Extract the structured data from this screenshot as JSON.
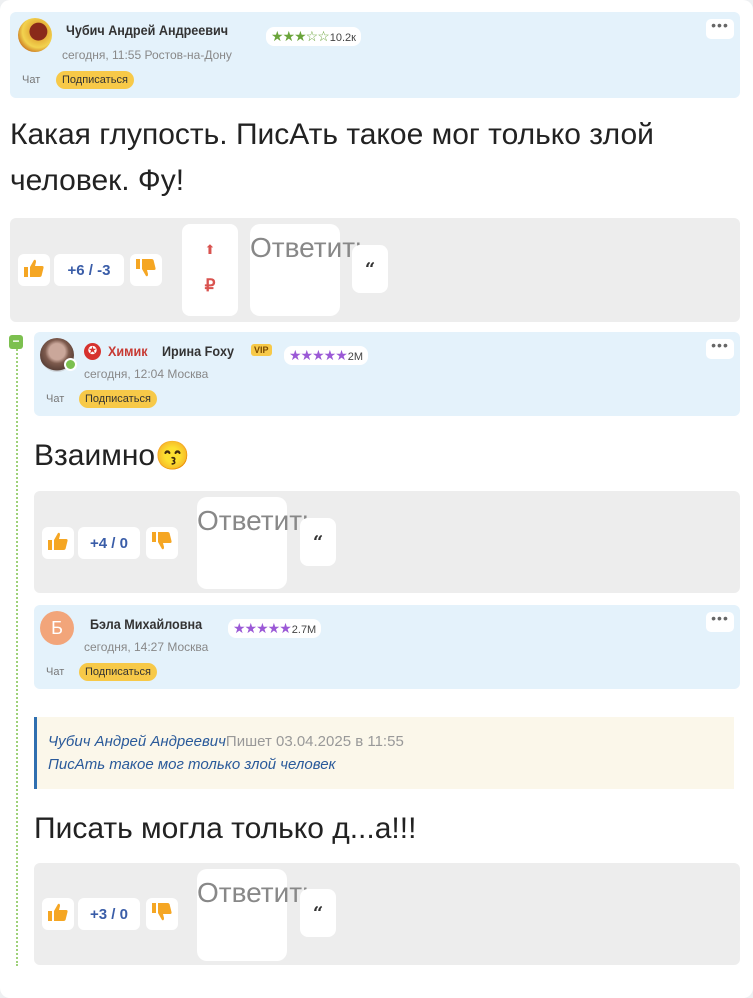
{
  "comment1": {
    "name": "Чубич Андрей Андреевич",
    "stars": "★★★☆☆",
    "rating": "10.2к",
    "meta": "сегодня, 11:55  Ростов-на-Дону",
    "chat_label": "Чат",
    "subscribe_label": "Подписаться",
    "text": "Какая глупость. ПисАть такое мог только злой человек. Фу!",
    "votes": "+6 / -3",
    "reply_label": "Ответить",
    "quote_symbol": "“",
    "donate_up": "⬆",
    "donate_currency": "₽"
  },
  "comment2": {
    "badge_name": "Химик",
    "name": "Ирина Foxy",
    "vip": "VIP",
    "stars": "★★★★★",
    "rating": "2M",
    "meta": "сегодня, 12:04  Москва",
    "chat_label": "Чат",
    "subscribe_label": "Подписаться",
    "text": "Взаимно",
    "emoji": "😙",
    "votes": "+4 / 0",
    "reply_label": "Ответить",
    "quote_symbol": "“"
  },
  "comment3": {
    "avatar_letter": "Б",
    "name": "Бэла Михайловна",
    "stars": "★★★★★",
    "rating": "2.7M",
    "meta": "сегодня, 14:27  Москва",
    "chat_label": "Чат",
    "subscribe_label": "Подписаться",
    "quote_author": "Чубич Андрей Андреевич",
    "quote_meta": "Пишет 03.04.2025 в 11:55",
    "quote_text": "ПисАть такое мог только злой человек",
    "text": "Писать могла только д...а!!!",
    "votes": "+3 / 0",
    "reply_label": "Ответить",
    "quote_symbol": "“"
  },
  "thread_toggle": "−",
  "menu_dots": "•••",
  "colors": {
    "header_bg": "#e4f2fb",
    "subscribe": "#f7c948",
    "thumb": "#f5a623",
    "votes": "#3a5da8"
  }
}
